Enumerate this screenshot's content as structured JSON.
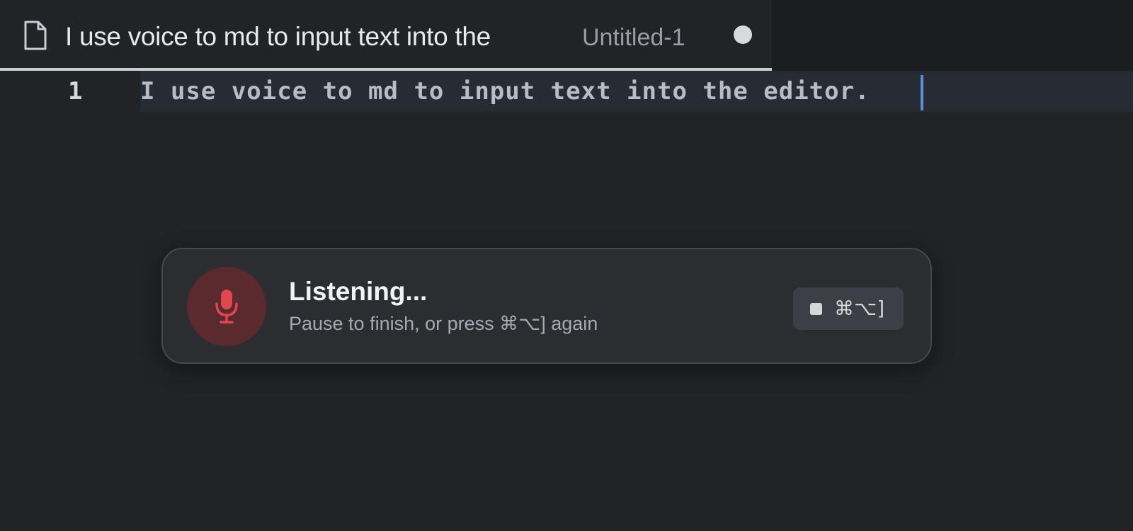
{
  "tab": {
    "title": "I use voice to md to input text into the",
    "description": "Untitled-1",
    "file_icon": "file-icon",
    "dirty_indicator": "unsaved-dot"
  },
  "editor": {
    "line_number": "1",
    "line_text": "I use voice to md to input text into the editor.",
    "cursor_color": "#5b8dd9"
  },
  "voice_popup": {
    "title": "Listening...",
    "hint": "Pause to finish, or press ⌘⌥] again",
    "mic_icon": "microphone-icon",
    "mic_color": "#e0464d",
    "stop_button": {
      "icon": "stop-icon",
      "shortcut": "⌘⌥]"
    }
  }
}
